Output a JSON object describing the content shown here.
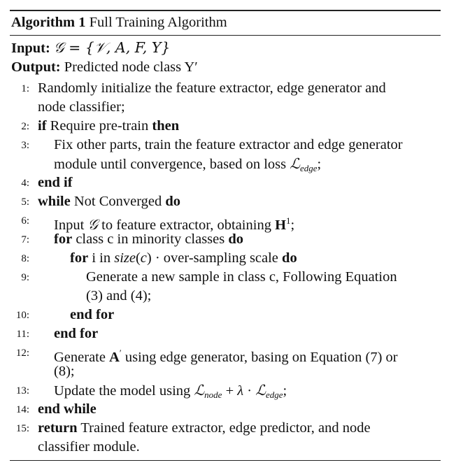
{
  "title": {
    "label": "Algorithm 1",
    "name": "Full Training Algorithm"
  },
  "input": {
    "label": "Input:",
    "text": "𝒢 = {𝒱, A, F, Y}"
  },
  "output": {
    "label": "Output:",
    "text": "Predicted node class Y′"
  },
  "lines": [
    {
      "n": "1:",
      "indent": 0,
      "parts": [
        {
          "t": "Randomly initialize the feature extractor, edge generator and"
        }
      ]
    },
    {
      "n": "",
      "indent": 0,
      "parts": [
        {
          "t": "node classifier;"
        }
      ]
    },
    {
      "n": "2:",
      "indent": 0,
      "parts": [
        {
          "t": "if",
          "kw": true
        },
        {
          "t": " Require pre-train "
        },
        {
          "t": "then",
          "kw": true
        }
      ]
    },
    {
      "n": "3:",
      "indent": 1,
      "parts": [
        {
          "t": "Fix other parts, train the feature extractor and edge generator"
        }
      ]
    },
    {
      "n": "",
      "indent": 1,
      "parts": [
        {
          "t": "module until convergence, based on loss "
        },
        {
          "t": "ℒ",
          "math": true
        },
        {
          "t": "edge",
          "sub": true
        },
        {
          "t": ";"
        }
      ]
    },
    {
      "n": "4:",
      "indent": 0,
      "parts": [
        {
          "t": "end if",
          "kw": true
        }
      ]
    },
    {
      "n": "5:",
      "indent": 0,
      "parts": [
        {
          "t": "while",
          "kw": true
        },
        {
          "t": " Not Converged "
        },
        {
          "t": "do",
          "kw": true
        }
      ]
    },
    {
      "n": "6:",
      "indent": 1,
      "parts": [
        {
          "t": "Input "
        },
        {
          "t": "𝒢",
          "math": true
        },
        {
          "t": " to feature extractor, obtaining "
        },
        {
          "t": "H",
          "bold": true
        },
        {
          "t": "1",
          "sup": true
        },
        {
          "t": ";"
        }
      ]
    },
    {
      "n": "7:",
      "indent": 1,
      "parts": [
        {
          "t": "for",
          "kw": true
        },
        {
          "t": " class c in minority classes "
        },
        {
          "t": "do",
          "kw": true
        }
      ]
    },
    {
      "n": "8:",
      "indent": 2,
      "parts": [
        {
          "t": "for",
          "kw": true
        },
        {
          "t": " i in "
        },
        {
          "t": "size",
          "it": true
        },
        {
          "t": "("
        },
        {
          "t": "c",
          "it": true
        },
        {
          "t": ") · over-sampling scale "
        },
        {
          "t": "do",
          "kw": true
        }
      ]
    },
    {
      "n": "9:",
      "indent": 3,
      "parts": [
        {
          "t": "Generate a new sample in class c, Following Equation"
        }
      ]
    },
    {
      "n": "",
      "indent": 3,
      "parts": [
        {
          "t": "(3) and (4);"
        }
      ]
    },
    {
      "n": "10:",
      "indent": 2,
      "parts": [
        {
          "t": "end for",
          "kw": true
        }
      ]
    },
    {
      "n": "11:",
      "indent": 1,
      "parts": [
        {
          "t": "end for",
          "kw": true
        }
      ]
    },
    {
      "n": "12:",
      "indent": 1,
      "parts": [
        {
          "t": "Generate "
        },
        {
          "t": "A",
          "bold": true
        },
        {
          "t": "′",
          "sup": true
        },
        {
          "t": " using edge generator, basing on Equation (7) or"
        }
      ]
    },
    {
      "n": "",
      "indent": 1,
      "parts": [
        {
          "t": "(8);"
        }
      ]
    },
    {
      "n": "13:",
      "indent": 1,
      "parts": [
        {
          "t": "Update the model using "
        },
        {
          "t": "ℒ",
          "math": true
        },
        {
          "t": "node",
          "sub": true
        },
        {
          "t": " + "
        },
        {
          "t": "λ",
          "it": true
        },
        {
          "t": " · "
        },
        {
          "t": "ℒ",
          "math": true
        },
        {
          "t": "edge",
          "sub": true
        },
        {
          "t": ";"
        }
      ]
    },
    {
      "n": "14:",
      "indent": 0,
      "parts": [
        {
          "t": "end while",
          "kw": true
        }
      ]
    },
    {
      "n": "15:",
      "indent": 0,
      "parts": [
        {
          "t": "return",
          "kw": true
        },
        {
          "t": "  Trained feature extractor, edge predictor, and node"
        }
      ]
    },
    {
      "n": "",
      "indent": 0,
      "parts": [
        {
          "t": "classifier module."
        }
      ]
    }
  ]
}
